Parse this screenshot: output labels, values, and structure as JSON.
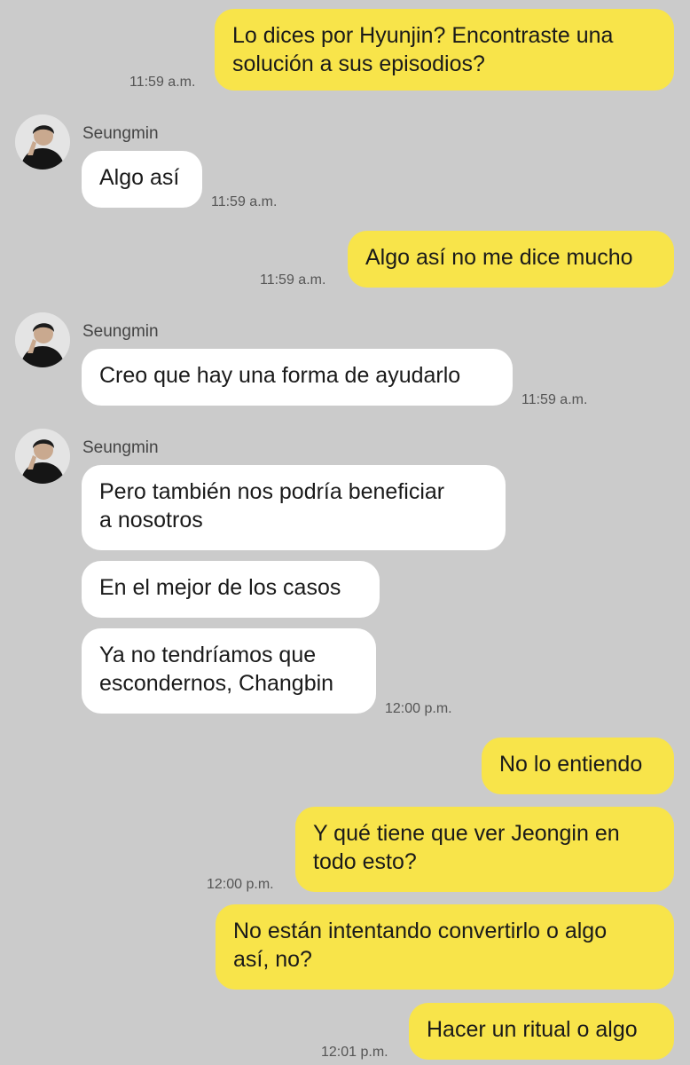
{
  "contact": {
    "name": "Seungmin"
  },
  "messages": [
    {
      "text": "Lo dices por Hyunjin? Encontraste una\nsolución a sus episodios?",
      "time": "11:59 a.m."
    },
    {
      "text": "Algo así",
      "time": "11:59 a.m."
    },
    {
      "text": "Algo así no me dice mucho",
      "time": "11:59 a.m."
    },
    {
      "text": "Creo que hay una forma de ayudarlo",
      "time": "11:59 a.m."
    },
    {
      "text": "Pero también nos podría beneficiar\na nosotros"
    },
    {
      "text": "En el mejor de los casos"
    },
    {
      "text": "Ya no tendríamos que\nescondernos, Changbin",
      "time": "12:00 p.m."
    },
    {
      "text": "No lo entiendo"
    },
    {
      "text": "Y qué tiene que ver Jeongin en\ntodo esto?",
      "time": "12:00 p.m."
    },
    {
      "text": "No están intentando convertirlo o algo\nasí, no?"
    },
    {
      "text": "Hacer un ritual o algo",
      "time": "12:01 p.m."
    }
  ],
  "colors": {
    "background": "#cbcbcb",
    "outgoing_bubble": "#f8e44a",
    "incoming_bubble": "#ffffff"
  }
}
